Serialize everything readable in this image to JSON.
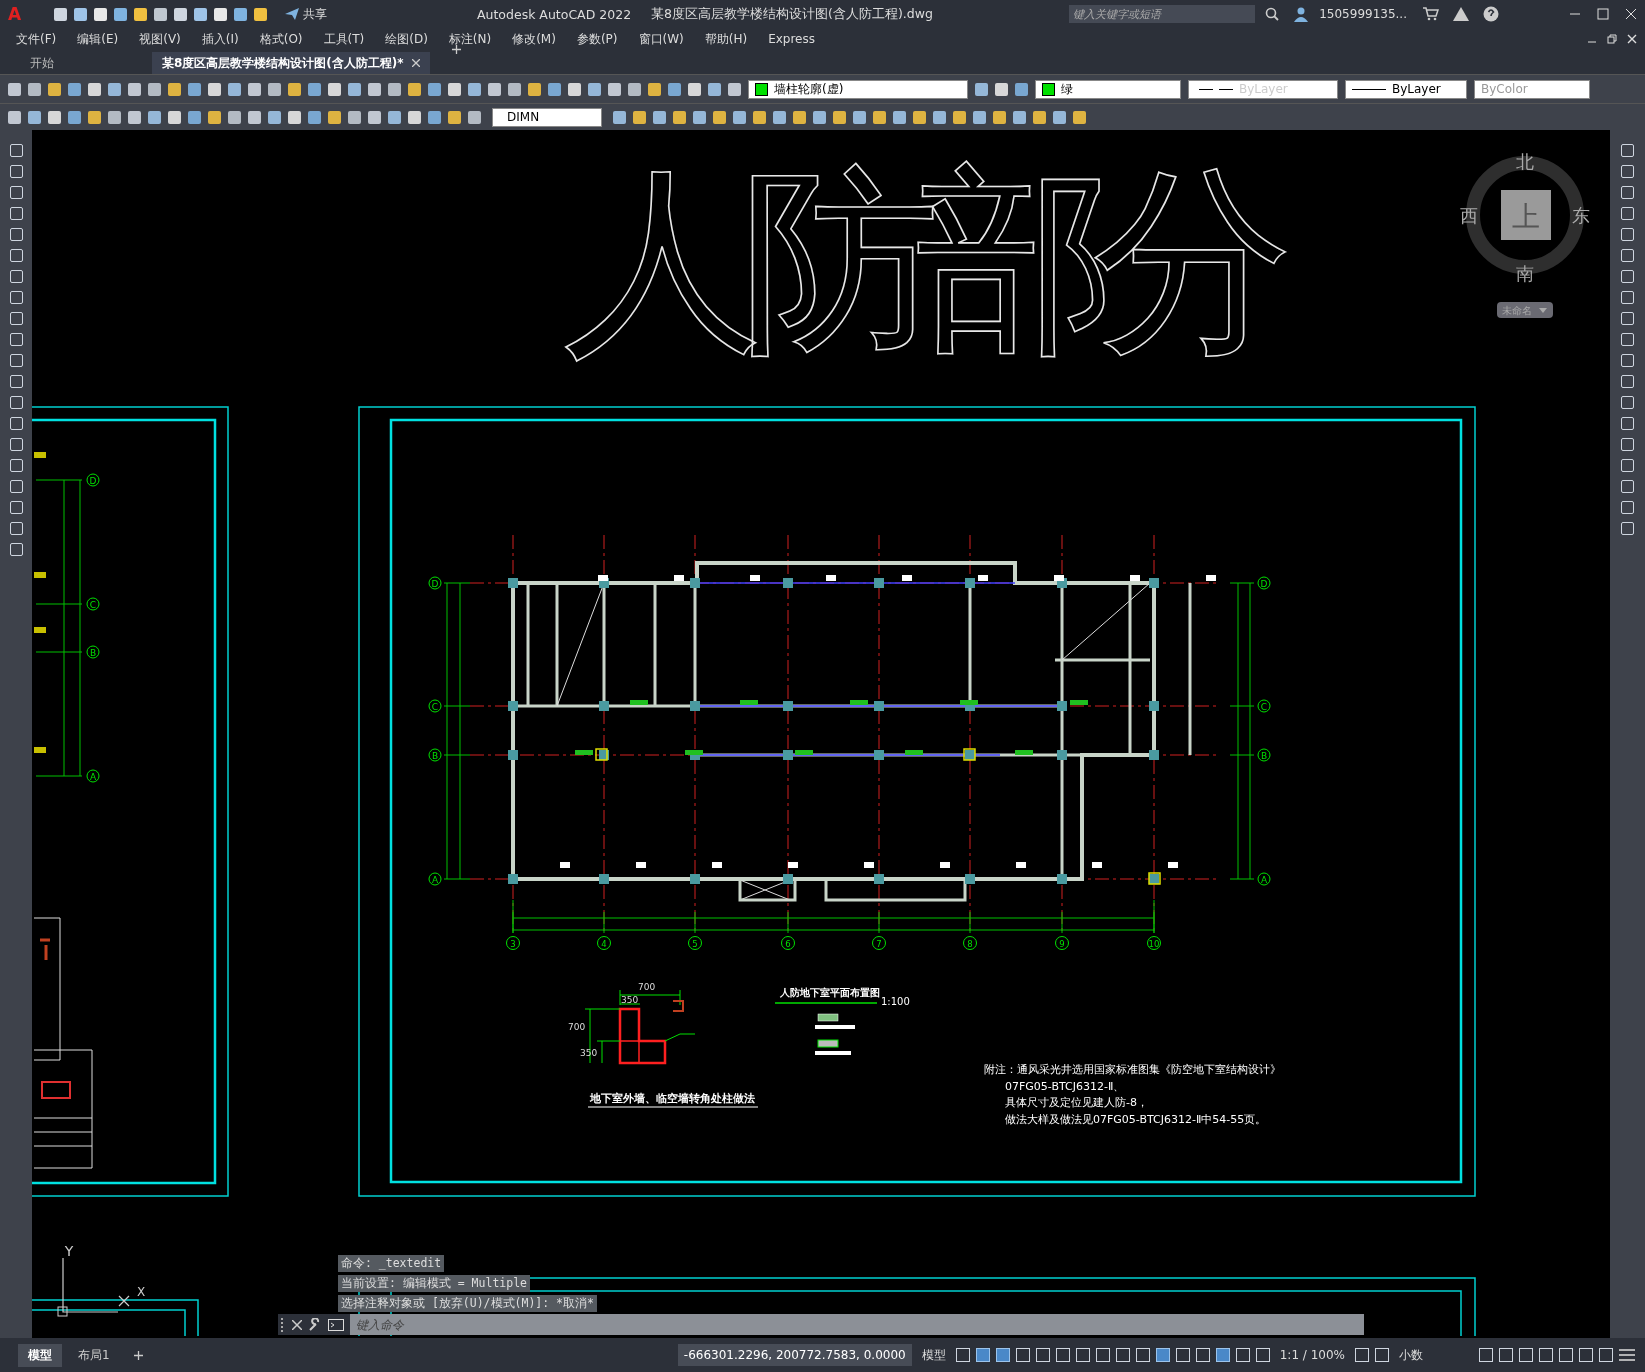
{
  "window": {
    "app_title": "Autodesk AutoCAD 2022",
    "file_title": "某8度区高层教学楼结构设计图(含人防工程).dwg"
  },
  "logo": "A",
  "quick_access": {
    "share": "共享"
  },
  "search": {
    "placeholder": "键入关键字或短语"
  },
  "user": "1505999135...",
  "menu": [
    "文件(F)",
    "编辑(E)",
    "视图(V)",
    "插入(I)",
    "格式(O)",
    "工具(T)",
    "绘图(D)",
    "标注(N)",
    "修改(M)",
    "参数(P)",
    "窗口(W)",
    "帮助(H)",
    "Express"
  ],
  "doc_tabs": [
    {
      "label": "开始",
      "selected": false
    },
    {
      "label": "某8度区高层教学楼结构设计图(含人防工程)*",
      "selected": true
    }
  ],
  "properties_toolbar": {
    "layer": "墙柱轮廓(虚)",
    "color_label": "绿",
    "linetype": "ByLayer",
    "lineweight": "ByLayer",
    "plot_style": "ByColor",
    "dim_style": "DIMN"
  },
  "viewcube": {
    "north": "北",
    "south": "南",
    "east": "东",
    "west": "西",
    "face": "上",
    "ucs": "未命名"
  },
  "drawing": {
    "banner": "人防部分",
    "left_sheet_axes": [
      "D",
      "C",
      "B",
      "A"
    ],
    "row_axes_left": [
      "D",
      "C",
      "B",
      "A"
    ],
    "row_axes_right": [
      "D",
      "C",
      "B",
      "A"
    ],
    "column_axes": [
      "3",
      "4",
      "5",
      "6",
      "7",
      "8",
      "9",
      "10"
    ],
    "detail_dims": [
      "700",
      "350",
      "700",
      "350"
    ],
    "detail_title": "地下室外墙、临空墙转角处柱做法",
    "plan_title": "人防地下室平面布置图",
    "plan_scale": "1:100",
    "notes": [
      "附注：通风采光井选用国家标准图集《防空地下室结构设计》",
      "07FG05-BTCJ6312-Ⅱ、",
      "具体尺寸及定位见建人防-8，",
      "做法大样及做法见07FG05-BTCJ6312-Ⅱ中54-55页。"
    ],
    "ucs": {
      "y": "Y",
      "x": "X"
    }
  },
  "command": {
    "history": [
      "命令: _textedit",
      "当前设置: 编辑模式 = Multiple",
      "选择注释对象或 [放弃(U)/模式(M)]: *取消*"
    ],
    "placeholder": "键入命令"
  },
  "layout_tabs": [
    {
      "label": "模型",
      "selected": true
    },
    {
      "label": "布局1",
      "selected": false
    }
  ],
  "status": {
    "coordinates": "-666301.2296, 200772.7583, 0.0000",
    "space": "模型",
    "scale": "1:1 / 100%",
    "units": "小数"
  }
}
